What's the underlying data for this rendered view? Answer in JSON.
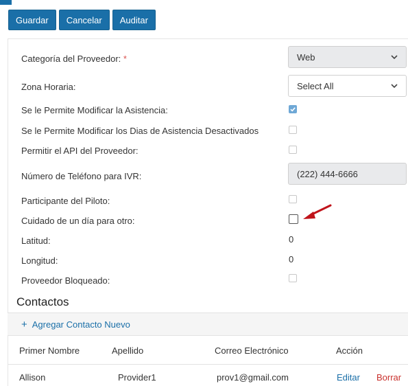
{
  "toolbar": {
    "save_label": "Guardar",
    "cancel_label": "Cancelar",
    "audit_label": "Auditar"
  },
  "form": {
    "category": {
      "label": "Categoría del Proveedor:",
      "required_mark": "*",
      "value": "Web"
    },
    "timezone": {
      "label": "Zona Horaria:",
      "value": "Select All"
    },
    "modify_attendance": {
      "label": "Se le Permite Modificar la Asistencia:",
      "checked": true
    },
    "modify_disabled_days": {
      "label": "Se le Permite Modificar los Dias de Asistencia Desactivados",
      "checked": false
    },
    "provider_api": {
      "label": "Permitir el API del Proveedor:",
      "checked": false
    },
    "ivr_phone": {
      "label": "Número de Teléfono para IVR:",
      "value": "(222) 444-6666"
    },
    "pilot_participant": {
      "label": "Participante del Piloto:",
      "checked": false
    },
    "overnight_care": {
      "label": "Cuidado de un día para otro:",
      "checked": false
    },
    "latitude": {
      "label": "Latitud:",
      "value": "0"
    },
    "longitude": {
      "label": "Longitud:",
      "value": "0"
    },
    "provider_blocked": {
      "label": "Proveedor Bloqueado:",
      "checked": false
    }
  },
  "contacts": {
    "title": "Contactos",
    "add_label": "Agregar Contacto Nuevo",
    "columns": [
      "Primer Nombre",
      "Apellido",
      "Correo Electrónico",
      "Acción"
    ],
    "rows": [
      {
        "first_name": "Allison",
        "last_name": "Provider1",
        "email": "prov1@gmail.com",
        "edit": "Editar",
        "delete": "Borrar"
      }
    ]
  },
  "colors": {
    "primary": "#1a6fa8",
    "delete": "#c9302c",
    "annotation_arrow": "#c0141b"
  }
}
